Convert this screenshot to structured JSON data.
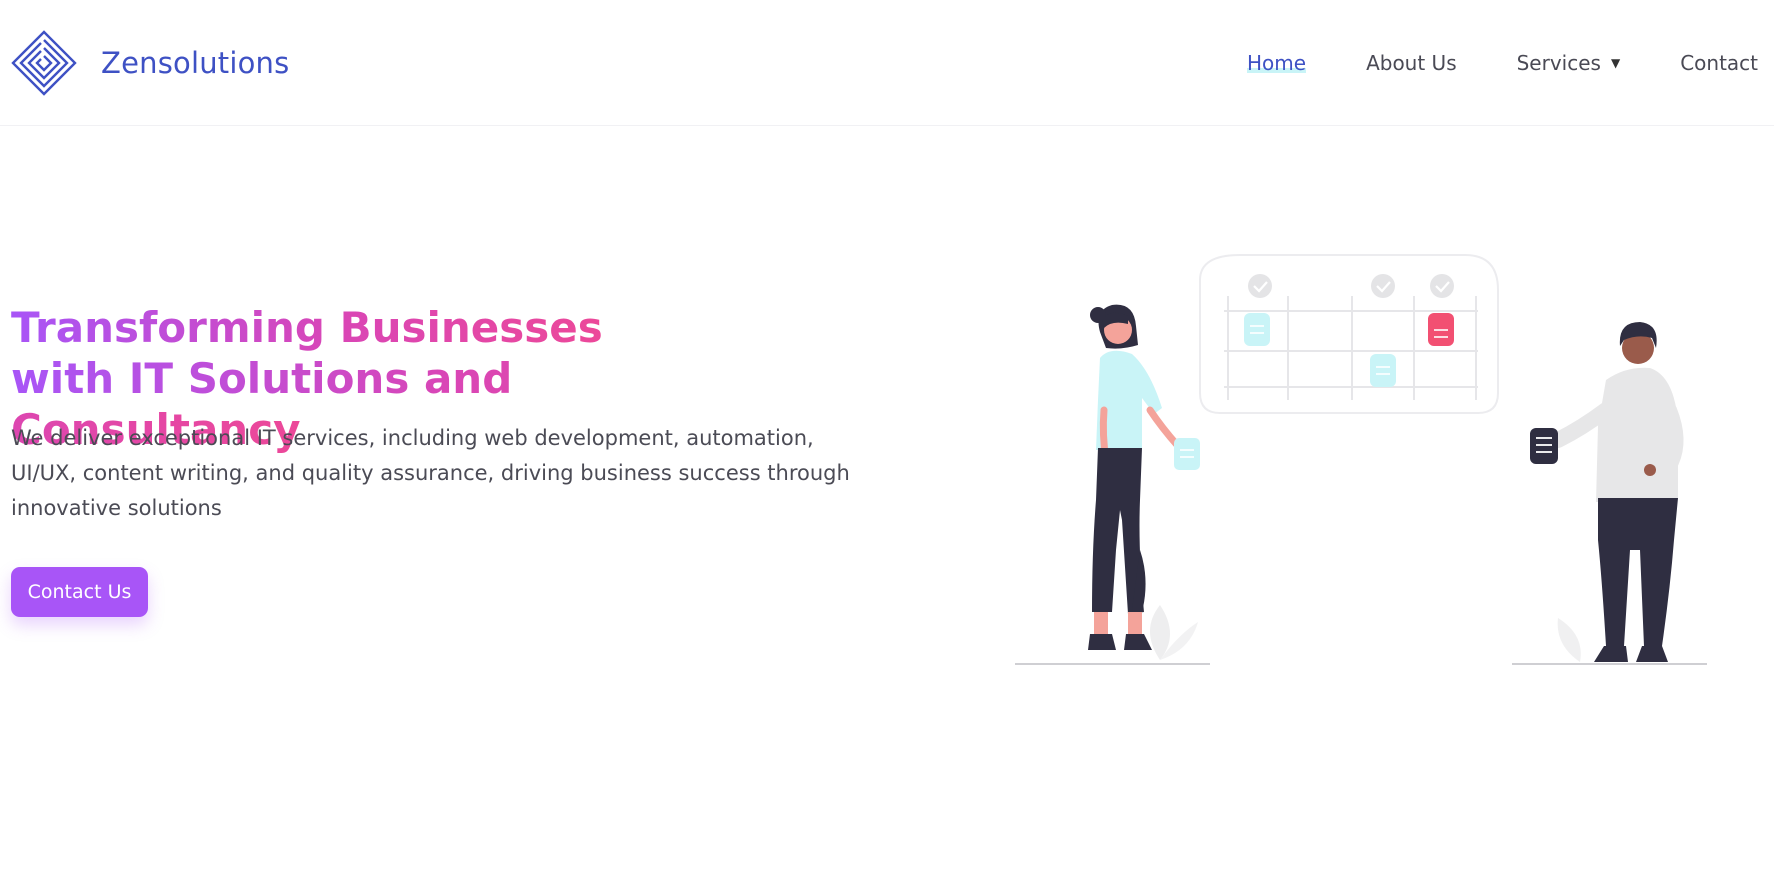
{
  "brand": {
    "name": "Zensolutions",
    "logo_icon": "diamond-maze-logo-icon"
  },
  "nav": {
    "items": [
      {
        "label": "Home",
        "active": true
      },
      {
        "label": "About Us"
      },
      {
        "label": "Services",
        "has_dropdown": true,
        "caret": "▼"
      },
      {
        "label": "Contact"
      }
    ]
  },
  "hero": {
    "title_line1": "Transforming Businesses",
    "title_line2": "with IT Solutions and Consultancy",
    "description": "We deliver exceptional IT services, including web development, automation, UI/UX, content writing, and quality assurance, driving business success through innovative solutions",
    "cta_label": "Contact Us",
    "illustration": "team-planning-board-illustration"
  },
  "colors": {
    "brand_blue": "#3e51c4",
    "accent_purple": "#a855f7",
    "accent_pink": "#ec4899",
    "text_gray": "#4b4b55",
    "highlight_cyan": "#c9f4f7",
    "card_red": "#f25072",
    "dark_navy": "#2f2e41"
  }
}
